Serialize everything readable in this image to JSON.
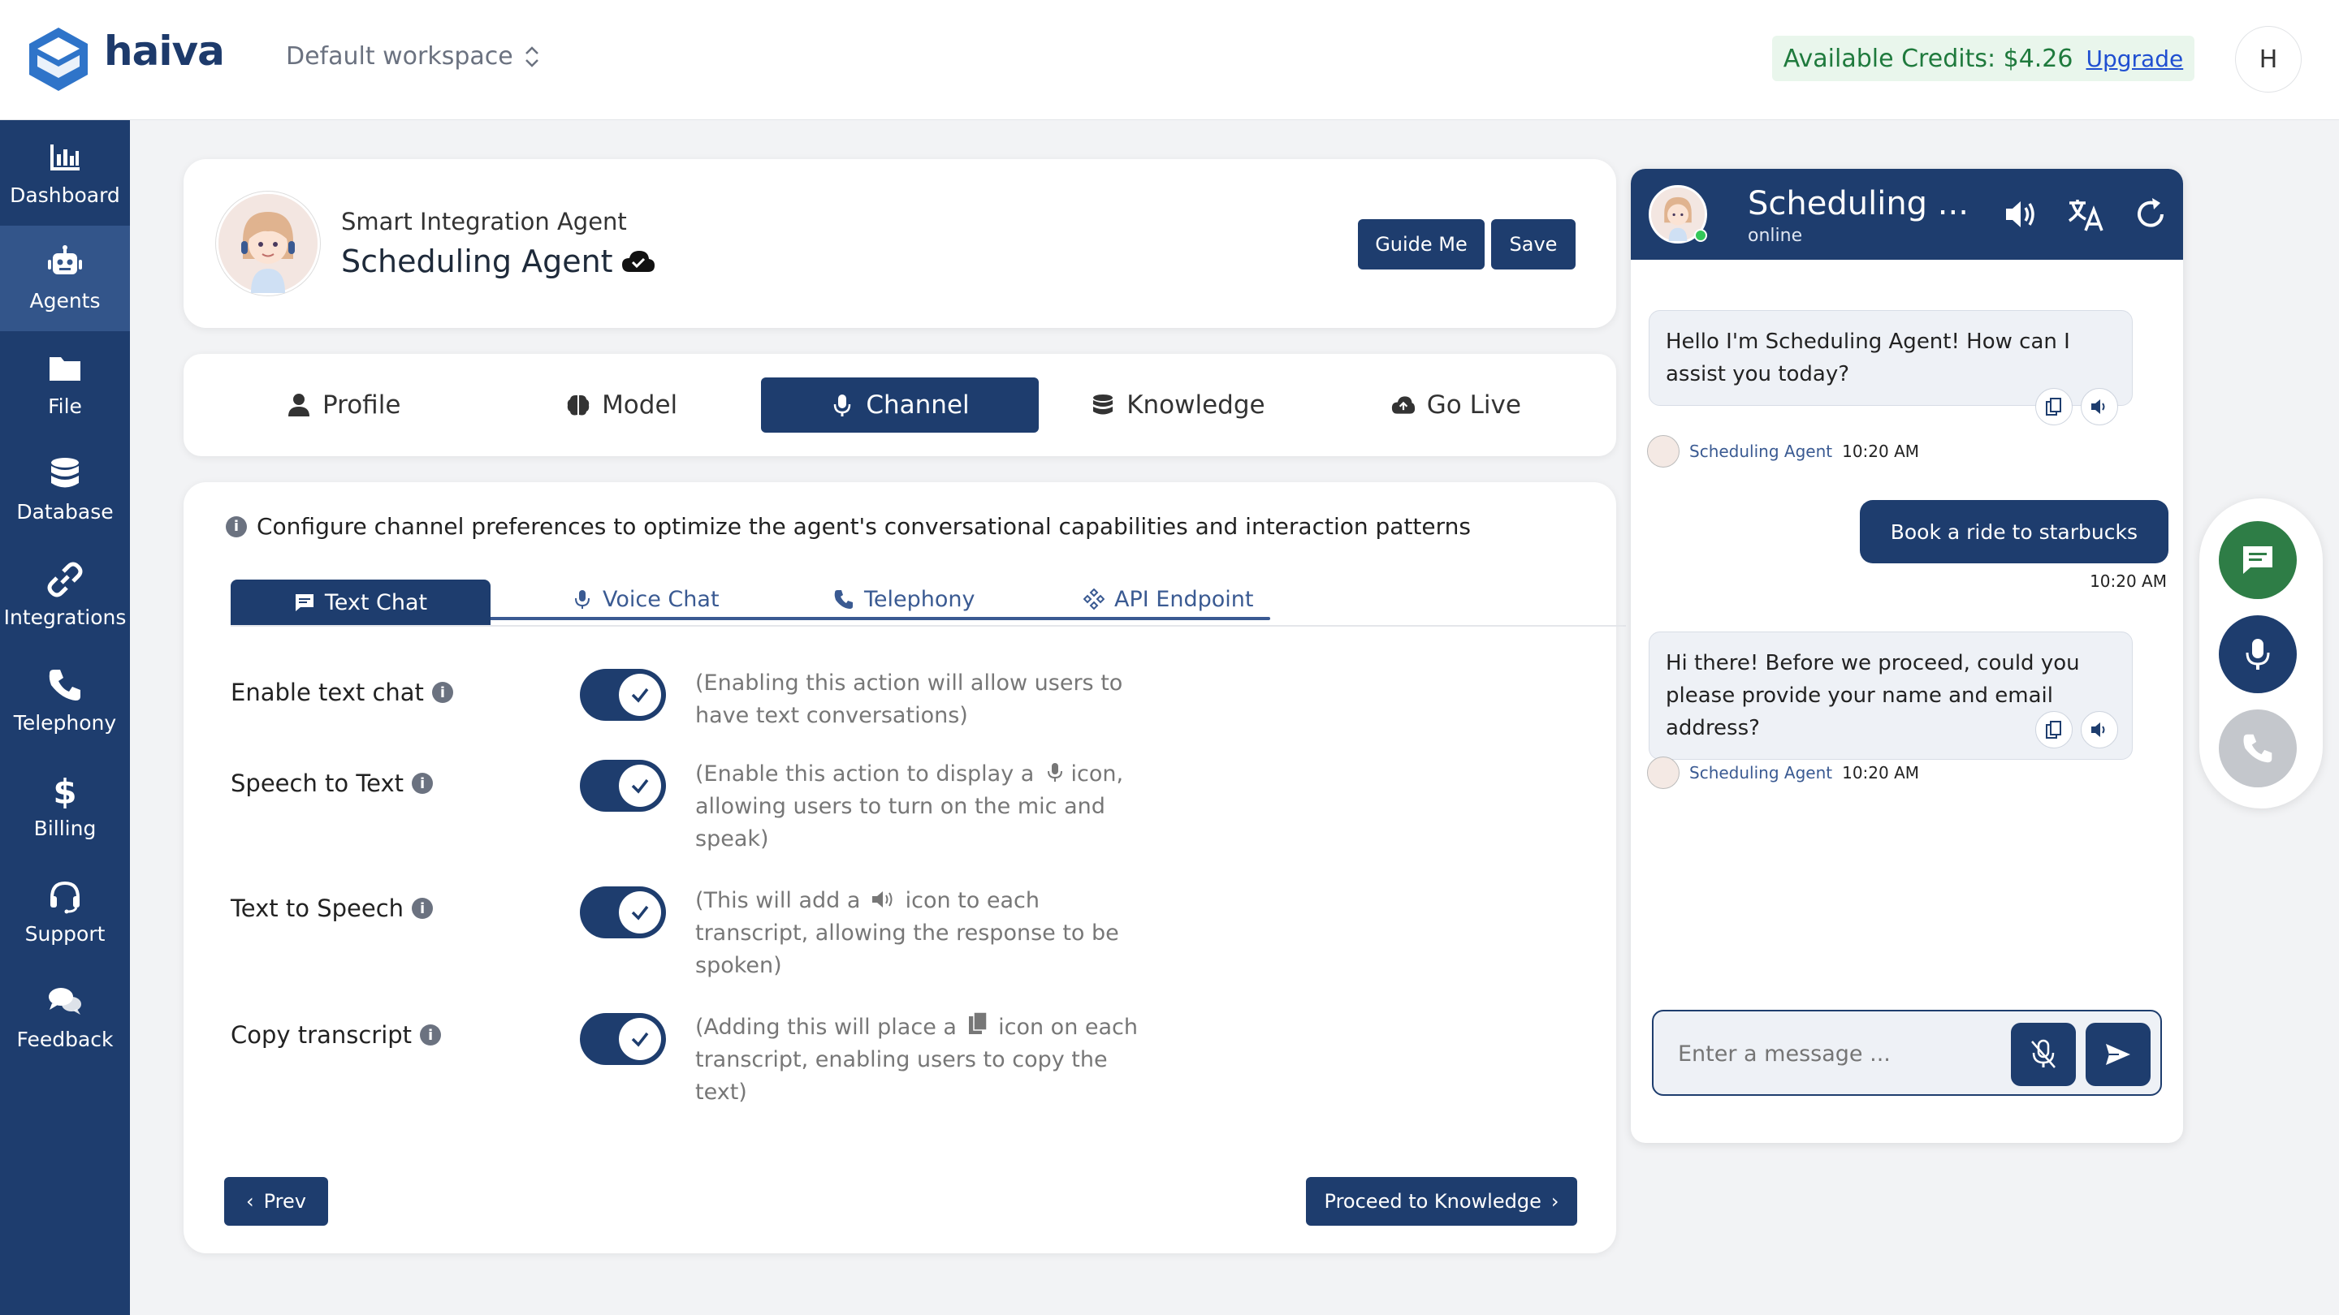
{
  "header": {
    "brand": "haiva",
    "workspace": "Default workspace",
    "credits_label": "Available Credits: $4.26",
    "upgrade_label": "Upgrade",
    "user_initial": "H"
  },
  "sidebar": {
    "items": [
      {
        "label": "Dashboard",
        "icon": "chart-icon"
      },
      {
        "label": "Agents",
        "icon": "robot-icon",
        "active": true
      },
      {
        "label": "File",
        "icon": "folder-icon"
      },
      {
        "label": "Database",
        "icon": "database-icon"
      },
      {
        "label": "Integrations",
        "icon": "link-icon"
      },
      {
        "label": "Telephony",
        "icon": "phone-icon"
      },
      {
        "label": "Billing",
        "icon": "dollar-icon"
      },
      {
        "label": "Support",
        "icon": "headset-icon"
      },
      {
        "label": "Feedback",
        "icon": "chat-bubbles-icon"
      }
    ]
  },
  "agent": {
    "subtitle": "Smart Integration Agent",
    "name": "Scheduling Agent",
    "guide_label": "Guide Me",
    "save_label": "Save"
  },
  "tabs": [
    {
      "label": "Profile",
      "icon": "user-icon"
    },
    {
      "label": "Model",
      "icon": "brain-icon"
    },
    {
      "label": "Channel",
      "icon": "mic-icon",
      "active": true
    },
    {
      "label": "Knowledge",
      "icon": "database-icon"
    },
    {
      "label": "Go Live",
      "icon": "cloud-upload-icon"
    }
  ],
  "channel": {
    "info": "Configure channel preferences to optimize the agent's conversational capabilities and interaction patterns",
    "subtabs": [
      {
        "label": "Text Chat",
        "icon": "message-icon",
        "active": true
      },
      {
        "label": "Voice Chat",
        "icon": "mic-icon"
      },
      {
        "label": "Telephony",
        "icon": "phone-icon"
      },
      {
        "label": "API Endpoint",
        "icon": "api-icon"
      }
    ],
    "settings": [
      {
        "label": "Enable text chat",
        "enabled": true,
        "desc": "(Enabling this action will allow users to have text conversations)"
      },
      {
        "label": "Speech to Text",
        "enabled": true,
        "desc_a": "(Enable this action to display a",
        "desc_b": "icon, allowing users to turn on the mic and speak)"
      },
      {
        "label": "Text to Speech",
        "enabled": true,
        "desc_a": "(This will add a",
        "desc_b": "icon to each transcript, allowing the response to be spoken)"
      },
      {
        "label": "Copy transcript",
        "enabled": true,
        "desc_a": "(Adding this will place a",
        "desc_b": "icon on each transcript, enabling users to copy the text)"
      }
    ],
    "prev_label": "Prev",
    "next_label": "Proceed to Knowledge"
  },
  "chat": {
    "title": "Scheduling ...",
    "status": "online",
    "messages": [
      {
        "from": "agent",
        "text": "Hello I'm Scheduling Agent! How can I assist you today?",
        "sender": "Scheduling Agent",
        "time": "10:20 AM"
      },
      {
        "from": "user",
        "text": "Book a ride to starbucks",
        "time": "10:20 AM"
      },
      {
        "from": "agent",
        "text": "Hi there! Before we proceed, could you please provide your name and email address?",
        "sender": "Scheduling Agent",
        "time": "10:20 AM"
      }
    ],
    "input_placeholder": "Enter a message ..."
  },
  "colors": {
    "navy": "#1e3d6e",
    "credits_green": "#1f7a3d",
    "fab_green": "#2e7d46",
    "fab_grey": "#c4c7cc"
  }
}
